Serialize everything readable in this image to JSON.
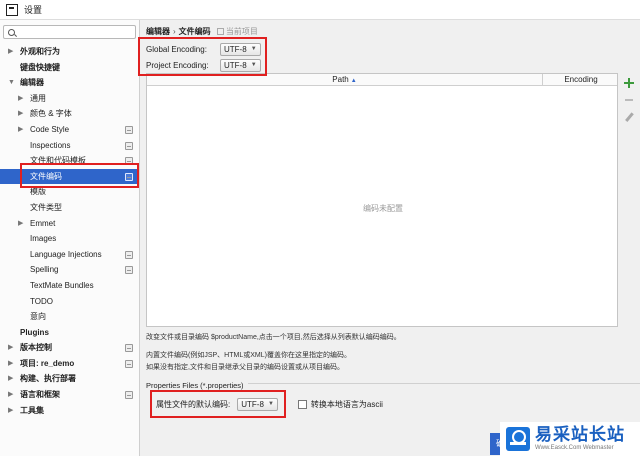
{
  "window": {
    "title": "设置"
  },
  "sidebar": {
    "search_placeholder": "",
    "items": [
      {
        "label": "外观和行为",
        "indent": 0,
        "arrow": "▶",
        "bold": true,
        "proj": false
      },
      {
        "label": "键盘快捷键",
        "indent": 0,
        "arrow": "",
        "bold": true,
        "proj": false
      },
      {
        "label": "编辑器",
        "indent": 0,
        "arrow": "▼",
        "bold": true,
        "proj": false
      },
      {
        "label": "通用",
        "indent": 1,
        "arrow": "▶",
        "bold": false,
        "proj": false
      },
      {
        "label": "颜色 & 字体",
        "indent": 1,
        "arrow": "▶",
        "bold": false,
        "proj": false
      },
      {
        "label": "Code Style",
        "indent": 1,
        "arrow": "▶",
        "bold": false,
        "proj": true
      },
      {
        "label": "Inspections",
        "indent": 1,
        "arrow": "",
        "bold": false,
        "proj": true
      },
      {
        "label": "文件和代码模板",
        "indent": 1,
        "arrow": "",
        "bold": false,
        "proj": true
      },
      {
        "label": "文件编码",
        "indent": 1,
        "arrow": "",
        "bold": false,
        "proj": true,
        "selected": true
      },
      {
        "label": "模版",
        "indent": 1,
        "arrow": "",
        "bold": false,
        "proj": false
      },
      {
        "label": "文件类型",
        "indent": 1,
        "arrow": "",
        "bold": false,
        "proj": false
      },
      {
        "label": "Emmet",
        "indent": 1,
        "arrow": "▶",
        "bold": false,
        "proj": false
      },
      {
        "label": "Images",
        "indent": 1,
        "arrow": "",
        "bold": false,
        "proj": false
      },
      {
        "label": "Language Injections",
        "indent": 1,
        "arrow": "",
        "bold": false,
        "proj": true
      },
      {
        "label": "Spelling",
        "indent": 1,
        "arrow": "",
        "bold": false,
        "proj": true
      },
      {
        "label": "TextMate Bundles",
        "indent": 1,
        "arrow": "",
        "bold": false,
        "proj": false
      },
      {
        "label": "TODO",
        "indent": 1,
        "arrow": "",
        "bold": false,
        "proj": false
      },
      {
        "label": "意向",
        "indent": 1,
        "arrow": "",
        "bold": false,
        "proj": false
      },
      {
        "label": "Plugins",
        "indent": 0,
        "arrow": "",
        "bold": true,
        "proj": false
      },
      {
        "label": "版本控制",
        "indent": 0,
        "arrow": "▶",
        "bold": true,
        "proj": true
      },
      {
        "label": "项目: re_demo",
        "indent": 0,
        "arrow": "▶",
        "bold": true,
        "proj": true
      },
      {
        "label": "构建、执行部署",
        "indent": 0,
        "arrow": "▶",
        "bold": true,
        "proj": false
      },
      {
        "label": "语言和框架",
        "indent": 0,
        "arrow": "▶",
        "bold": true,
        "proj": true
      },
      {
        "label": "工具集",
        "indent": 0,
        "arrow": "▶",
        "bold": true,
        "proj": false
      }
    ]
  },
  "breadcrumb": {
    "part1": "编辑器",
    "separator": "›",
    "part2": "文件编码",
    "hint": "当前项目"
  },
  "encoding": {
    "global_label": "Global Encoding:",
    "global_value": "UTF-8",
    "project_label": "Project Encoding:",
    "project_value": "UTF-8",
    "dropdown_glyph": "▼"
  },
  "table": {
    "col_path": "Path",
    "sort_glyph": "▲",
    "col_encoding": "Encoding",
    "empty_text": "编码未配置"
  },
  "description": {
    "line1": "改变文件或目录编码 $productName,点击一个项目,然后选择从列表默认编码编码。",
    "line2": "内置文件编码(例如JSP、HTML或XML)覆盖你在这里指定的编码。",
    "line3": "如果没有指定,文件和目录继承父目录的编码设置或从项目编码。"
  },
  "properties": {
    "section_title": "Properties Files (*.properties)",
    "default_label": "属性文件的默认编码:",
    "default_value": "UTF-8",
    "ascii_label": "转换本地语言为ascii"
  },
  "footer": {
    "ok_partial": "确"
  },
  "watermark": {
    "main": "易采站长站",
    "sub": "Www.Easck.Com Webmaster"
  },
  "colors": {
    "selection": "#2f65ca",
    "highlight": "#e02020",
    "add": "#3c9a3c"
  }
}
